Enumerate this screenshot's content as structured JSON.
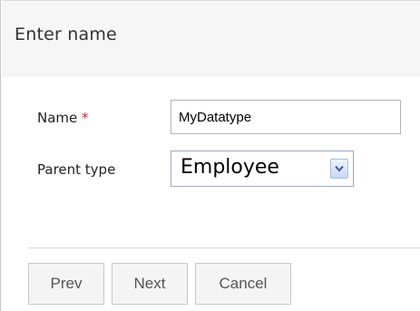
{
  "dialog": {
    "title": "Enter name"
  },
  "form": {
    "name_label": "Name",
    "required_marker": "*",
    "name_value": "MyDatatype",
    "parent_type_label": "Parent type",
    "parent_type_selected": "Employee"
  },
  "buttons": {
    "prev_label": "Prev",
    "next_label": "Next",
    "cancel_label": "Cancel"
  },
  "colors": {
    "required_marker": "#e02020",
    "title_bar": "#f6f6f6",
    "button_background": "#f4f4f4"
  },
  "icons": {
    "select_arrow": "chevron-down-icon"
  }
}
